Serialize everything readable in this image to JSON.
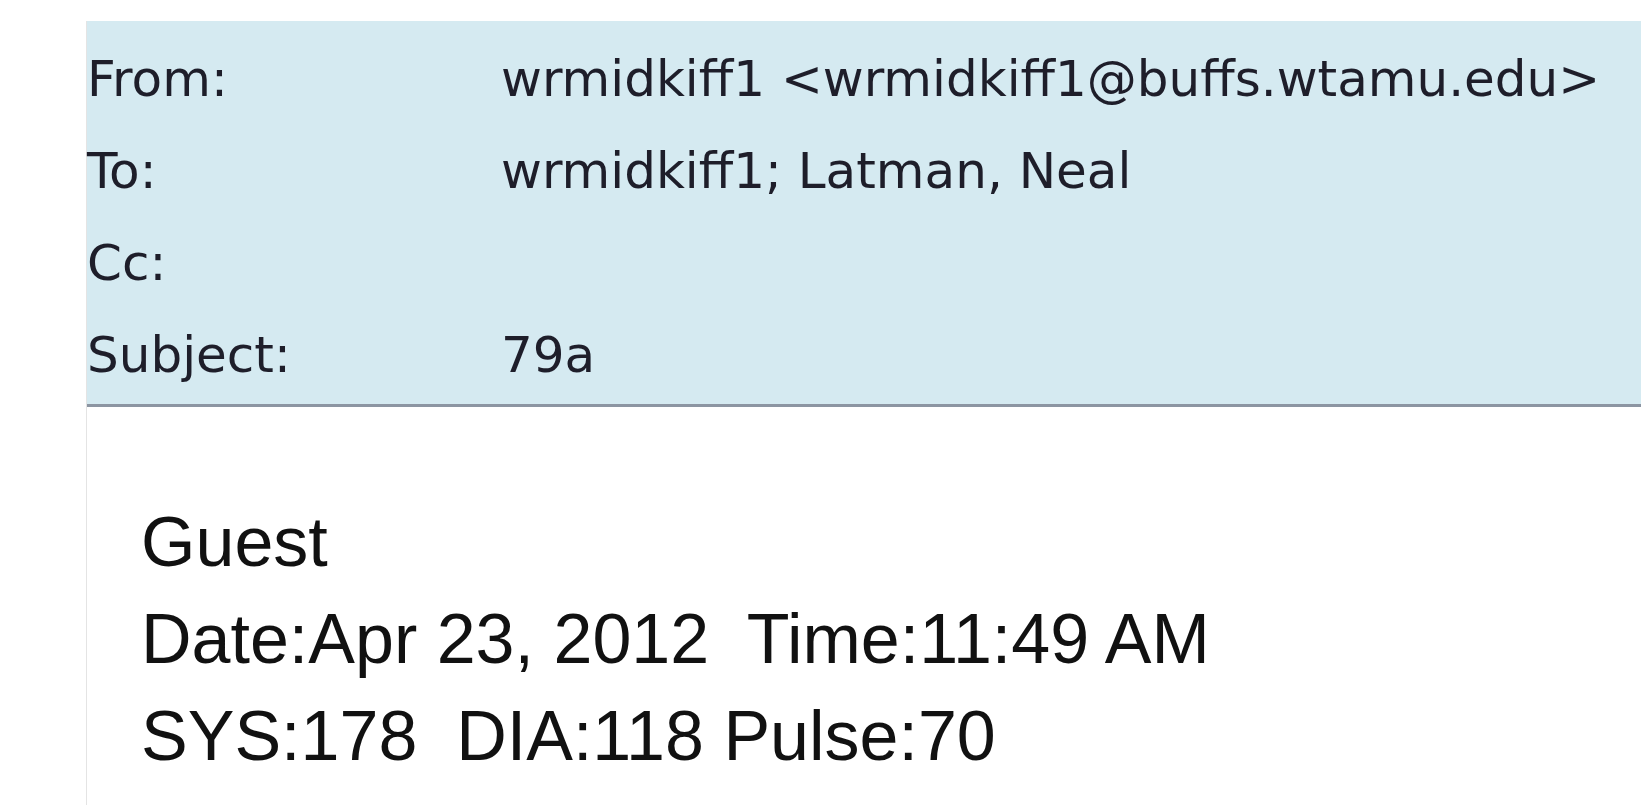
{
  "header": {
    "fields": [
      {
        "label": "From:",
        "value": "wrmidkiff1 <wrmidkiff1@buffs.wtamu.edu>"
      },
      {
        "label": "To:",
        "value": "wrmidkiff1; Latman, Neal"
      },
      {
        "label": "Cc:"
      },
      {
        "label": "Subject:",
        "value": "79a"
      }
    ]
  },
  "body": {
    "lines": [
      "Guest",
      "Date:Apr 23, 2012  Time:11:49 AM",
      "SYS:178  DIA:118 Pulse:70"
    ]
  }
}
